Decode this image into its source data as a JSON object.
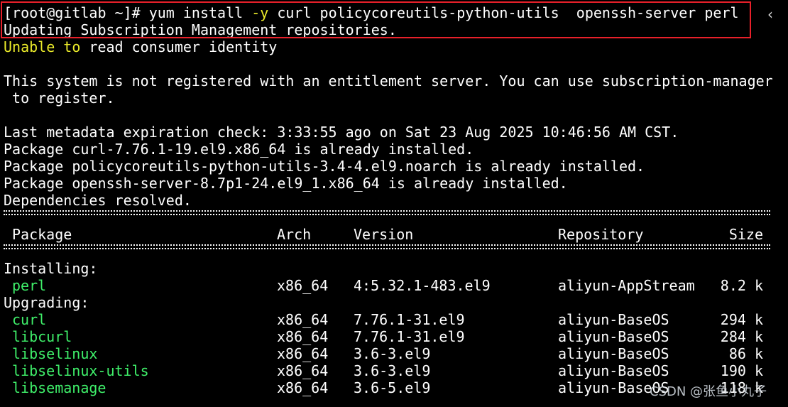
{
  "terminal": {
    "lines": [
      {
        "segments": [
          {
            "t": "[root@gitlab ~]# yum install ",
            "c": "w"
          },
          {
            "t": "-y",
            "c": "y"
          },
          {
            "t": " curl policycoreutils-python-utils  openssh-server perl",
            "c": "w"
          }
        ]
      },
      {
        "segments": [
          {
            "t": "Updating Subscription Management repositories.",
            "c": "w"
          }
        ]
      },
      {
        "segments": [
          {
            "t": "Unable",
            "c": "y"
          },
          {
            "t": " ",
            "c": "w"
          },
          {
            "t": "to",
            "c": "y"
          },
          {
            "t": " read consumer identity",
            "c": "w"
          }
        ]
      },
      {
        "segments": [
          {
            "t": "",
            "c": "w"
          }
        ]
      },
      {
        "segments": [
          {
            "t": "This system is not registered with an entitlement server. You can use subscription-manager",
            "c": "w"
          }
        ]
      },
      {
        "segments": [
          {
            "t": " to register.",
            "c": "w"
          }
        ]
      },
      {
        "segments": [
          {
            "t": "",
            "c": "w"
          }
        ]
      },
      {
        "segments": [
          {
            "t": "Last metadata expiration check: 3:33:55 ago on Sat 23 Aug 2025 10:46:56 AM CST.",
            "c": "w"
          }
        ]
      },
      {
        "segments": [
          {
            "t": "Package curl-7.76.1-19.el9.x86_64 is already installed.",
            "c": "w"
          }
        ]
      },
      {
        "segments": [
          {
            "t": "Package policycoreutils-python-utils-3.4-4.el9.noarch is already installed.",
            "c": "w"
          }
        ]
      },
      {
        "segments": [
          {
            "t": "Package openssh-server-8.7p1-24.el9_1.x86_64 is already installed.",
            "c": "w"
          }
        ]
      },
      {
        "segments": [
          {
            "t": "Dependencies resolved.",
            "c": "w"
          }
        ]
      }
    ],
    "table": {
      "headers": {
        "package": "Package",
        "arch": "Arch",
        "version": "Version",
        "repository": "Repository",
        "size": "Size"
      },
      "sections": [
        {
          "title": "Installing:",
          "rows": [
            {
              "package": "perl",
              "arch": "x86_64",
              "version": "4:5.32.1-483.el9",
              "repository": "aliyun-AppStream",
              "size": "8.2 k"
            }
          ]
        },
        {
          "title": "Upgrading:",
          "rows": [
            {
              "package": "curl",
              "arch": "x86_64",
              "version": "7.76.1-31.el9",
              "repository": "aliyun-BaseOS",
              "size": "294 k"
            },
            {
              "package": "libcurl",
              "arch": "x86_64",
              "version": "7.76.1-31.el9",
              "repository": "aliyun-BaseOS",
              "size": "284 k"
            },
            {
              "package": "libselinux",
              "arch": "x86_64",
              "version": "3.6-3.el9",
              "repository": "aliyun-BaseOS",
              "size": "86 k"
            },
            {
              "package": "libselinux-utils",
              "arch": "x86_64",
              "version": "3.6-3.el9",
              "repository": "aliyun-BaseOS",
              "size": "190 k"
            },
            {
              "package": "libsemanage",
              "arch": "x86_64",
              "version": "3.6-5.el9",
              "repository": "aliyun-BaseOS",
              "size": "118 k"
            }
          ]
        }
      ]
    },
    "colors": {
      "background": "#000000",
      "text": "#ffffff",
      "option": "#ecec2a",
      "package": "#3ff06a",
      "highlight_box": "#e8202a"
    }
  },
  "side": {
    "collapse_icon": "chevron-left-icon",
    "glyph": "‹"
  },
  "watermark": {
    "text": "CSDN @张鱼小丸子"
  }
}
